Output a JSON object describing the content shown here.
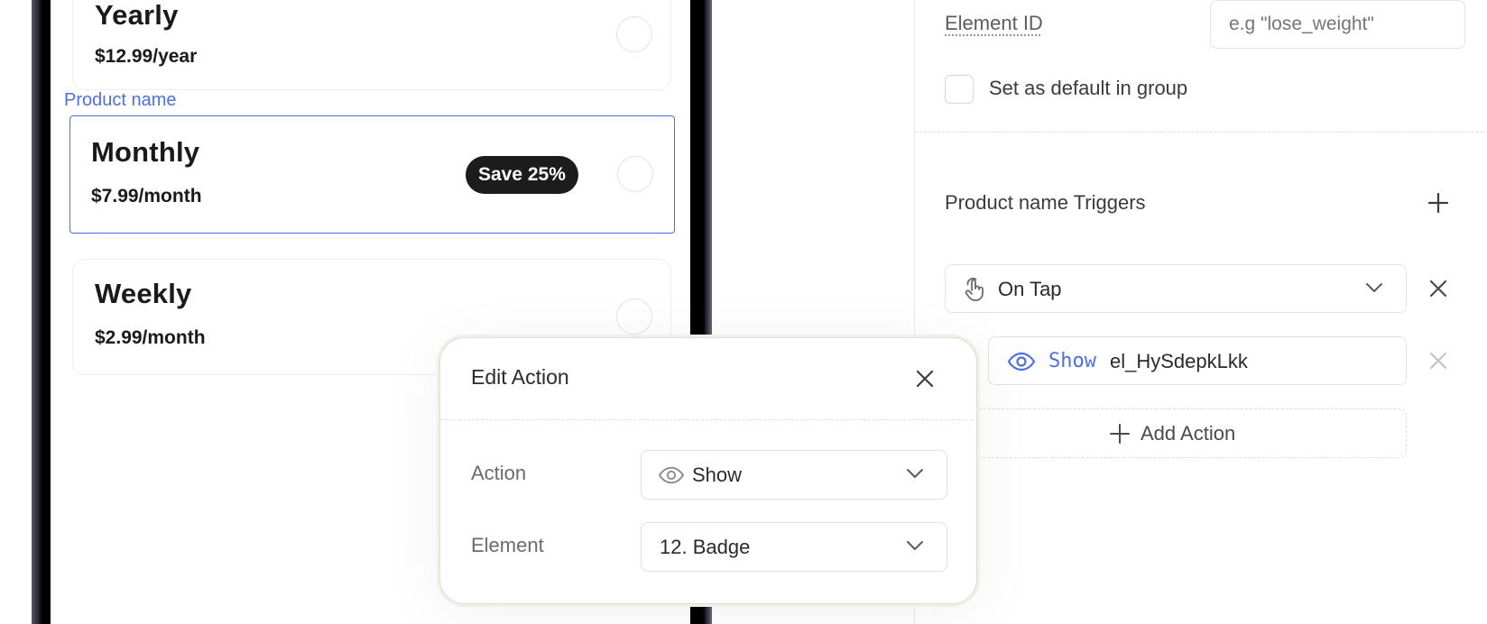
{
  "phone": {
    "product_label": "Product name",
    "plans": [
      {
        "name": "Yearly",
        "price": "$12.99/year",
        "badge": ""
      },
      {
        "name": "Monthly",
        "price": "$7.99/month",
        "badge": "Save 25%"
      },
      {
        "name": "Weekly",
        "price": "$2.99/month",
        "badge": ""
      }
    ],
    "selected_plan_index": 1
  },
  "panel": {
    "element_id_label": "Element ID",
    "element_id_placeholder": "e.g \"lose_weight\"",
    "default_checkbox_label": "Set as default in group",
    "triggers_title": "Product name Triggers",
    "trigger": {
      "icon": "tap-hand-icon",
      "label": "On Tap"
    },
    "action": {
      "icon": "eye-icon",
      "keyword": "Show",
      "target": "el_HySdepkLkk"
    },
    "add_action_label": "Add Action"
  },
  "popup": {
    "title": "Edit Action",
    "action_label": "Action",
    "action_value": "Show",
    "element_label": "Element",
    "element_value": "12. Badge"
  },
  "colors": {
    "accent": "#4f6fe0",
    "badge_bg": "#1c1c1c"
  }
}
